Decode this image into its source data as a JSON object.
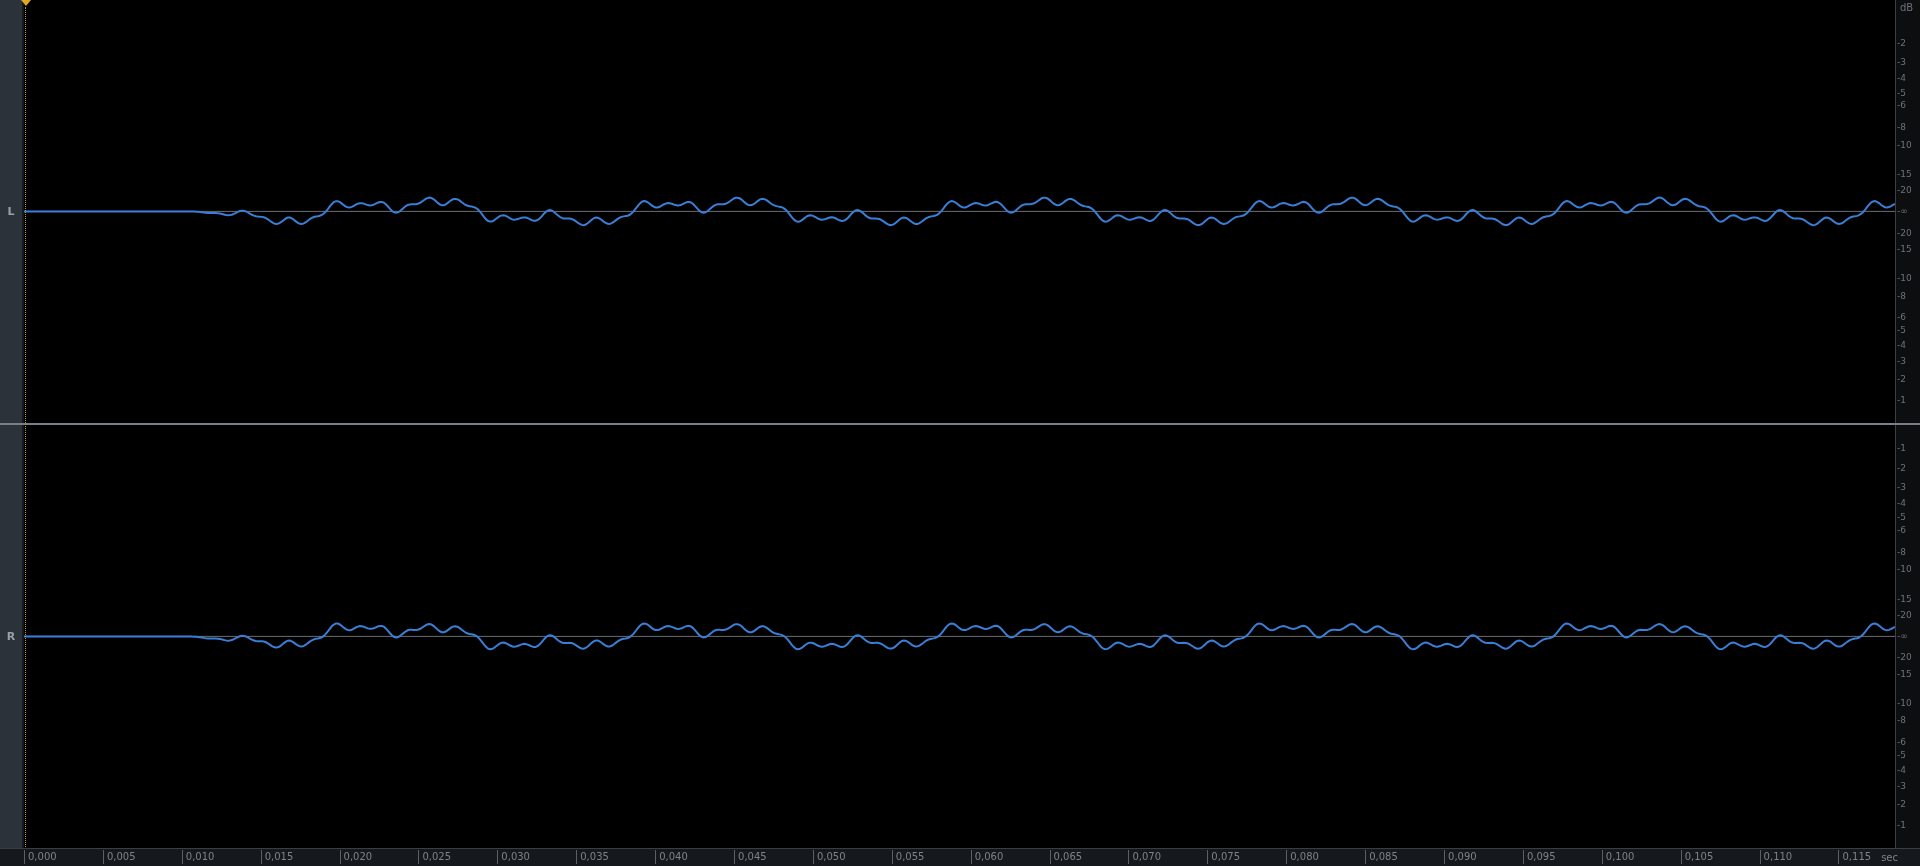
{
  "channels": [
    {
      "label": "L",
      "unit": "dB",
      "scale_upper": [
        "-2",
        "-3",
        "-4",
        "-5",
        "-6",
        "-8",
        "-10",
        "-15",
        "-20"
      ],
      "scale_center": "-∞",
      "scale_lower": [
        "-20",
        "-15",
        "-10",
        "-8",
        "-6",
        "-5",
        "-4",
        "-3",
        "-2",
        "-1"
      ]
    },
    {
      "label": "R",
      "scale_upper": [
        "-1",
        "-2",
        "-3",
        "-4",
        "-5",
        "-6",
        "-8",
        "-10",
        "-15",
        "-20"
      ],
      "scale_center": "-∞",
      "scale_lower": [
        "-20",
        "-15",
        "-10",
        "-8",
        "-6",
        "-5",
        "-4",
        "-3",
        "-2",
        "-1"
      ]
    }
  ],
  "time_axis": {
    "ticks": [
      "0,000",
      "0,005",
      "0,010",
      "0,015",
      "0,020",
      "0,025",
      "0,030",
      "0,035",
      "0,040",
      "0,045",
      "0,050",
      "0,055",
      "0,060",
      "0,065",
      "0,070",
      "0,075",
      "0,080",
      "0,085",
      "0,090",
      "0,095",
      "0,100",
      "0,105",
      "0,110",
      "0,115"
    ],
    "unit": "sec"
  }
}
